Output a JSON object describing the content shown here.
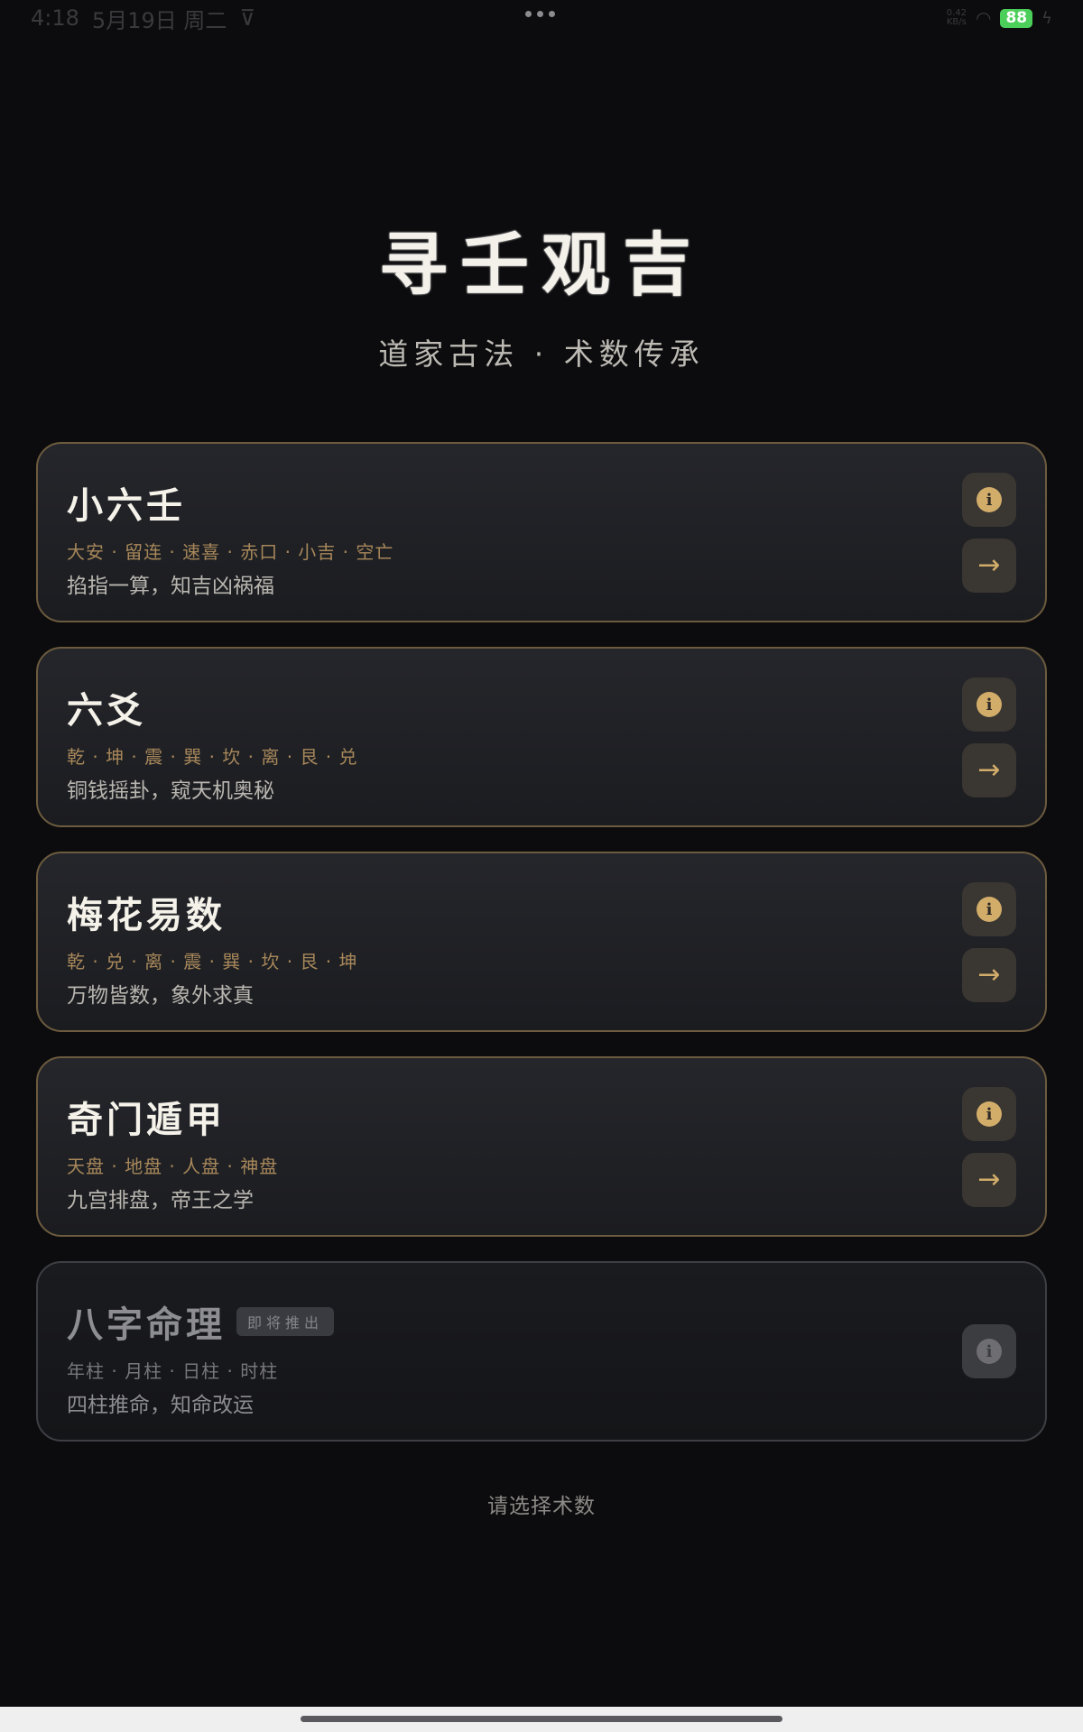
{
  "status_bar": {
    "time": "4:18",
    "date": "5月19日 周二",
    "net_speed": "0.42\nKB/s",
    "battery": "88"
  },
  "header": {
    "title": "寻壬观吉",
    "subtitle": "道家古法 · 术数传承"
  },
  "cards": [
    {
      "title": "小六壬",
      "tags": "大安 · 留连 · 速喜 · 赤口 · 小吉 · 空亡",
      "description": "掐指一算，知吉凶祸福",
      "info_icon": "info-icon",
      "arrow_icon": "arrow-right-icon",
      "arrow": "→"
    },
    {
      "title": "六爻",
      "tags": "乾 · 坤 · 震 · 巽 · 坎 · 离 · 艮 · 兑",
      "description": "铜钱摇卦，窥天机奥秘",
      "info_icon": "info-icon",
      "arrow_icon": "arrow-right-icon",
      "arrow": "→"
    },
    {
      "title": "梅花易数",
      "tags": "乾 · 兑 · 离 · 震 · 巽 · 坎 · 艮 · 坤",
      "description": "万物皆数，象外求真",
      "info_icon": "info-icon",
      "arrow_icon": "arrow-right-icon",
      "arrow": "→"
    },
    {
      "title": "奇门遁甲",
      "tags": "天盘 · 地盘 · 人盘 · 神盘",
      "description": "九宫排盘，帝王之学",
      "info_icon": "info-icon",
      "arrow_icon": "arrow-right-icon",
      "arrow": "→"
    },
    {
      "title": "八字命理",
      "badge": "即将推出",
      "tags": "年柱 · 月柱 · 日柱 · 时柱",
      "description": "四柱推命，知命改运",
      "info_icon": "info-icon"
    }
  ],
  "prompt": "请选择术数",
  "colors": {
    "background": "#0c0c0e",
    "accent_gold": "#d2ad6a",
    "card_border": "#6c5b3e"
  }
}
